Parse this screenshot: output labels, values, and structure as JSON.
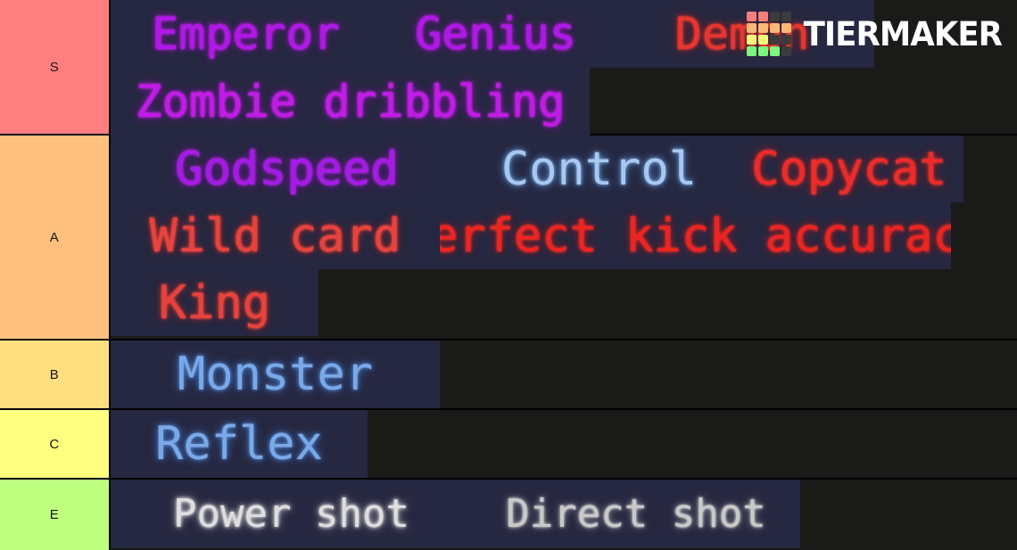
{
  "watermark": {
    "brand": "TIERMAKER",
    "logo_name": "tiermaker-logo",
    "grid_colors": [
      [
        "#f97e7e",
        "#f97e7e",
        "#3c3c3c",
        "#3c3c3c"
      ],
      [
        "#f9b878",
        "#f9b878",
        "#f9b878",
        "#f9b878"
      ],
      [
        "#f7f87c",
        "#f7f87c",
        "#3c3c3c",
        "#3c3c3c"
      ],
      [
        "#7cf97c",
        "#7cf97c",
        "#7cf97c",
        "#3c3c3c"
      ]
    ]
  },
  "tiers": [
    {
      "label": "S",
      "color": "#ff7f7f",
      "lines": [
        [
          {
            "text": "Emperor",
            "color": "#b018e8"
          },
          {
            "text": "Genius",
            "color": "#b018e8"
          },
          {
            "text": "Demon",
            "color": "#e8352e"
          }
        ],
        [
          {
            "text": "Zombie dribbling",
            "color": "#c31ae8"
          }
        ]
      ]
    },
    {
      "label": "A",
      "color": "#ffbf7f",
      "lines": [
        [
          {
            "text": "Godspeed",
            "color": "#a61ae8"
          },
          {
            "text": "Control",
            "color": "#a8c8ef"
          },
          {
            "text": "Copycat",
            "color": "#ef2a28"
          }
        ],
        [
          {
            "text": "Wild card",
            "color": "#e8423c"
          },
          {
            "text": "Perfect kick accuracy",
            "color": "#ef2320"
          }
        ],
        [
          {
            "text": "King",
            "color": "#e8423c"
          }
        ]
      ]
    },
    {
      "label": "B",
      "color": "#ffdf7f",
      "lines": [
        [
          {
            "text": "Monster",
            "color": "#7aa9e8"
          }
        ]
      ]
    },
    {
      "label": "C",
      "color": "#ffff7f",
      "lines": [
        [
          {
            "text": "Reflex",
            "color": "#7aa9e8"
          }
        ]
      ]
    },
    {
      "label": "E",
      "color": "#bfff7f",
      "lines": [
        [
          {
            "text": "Power shot",
            "color": "#dedede"
          },
          {
            "text": "Direct shot",
            "color": "#c9c9c9"
          }
        ]
      ]
    }
  ]
}
